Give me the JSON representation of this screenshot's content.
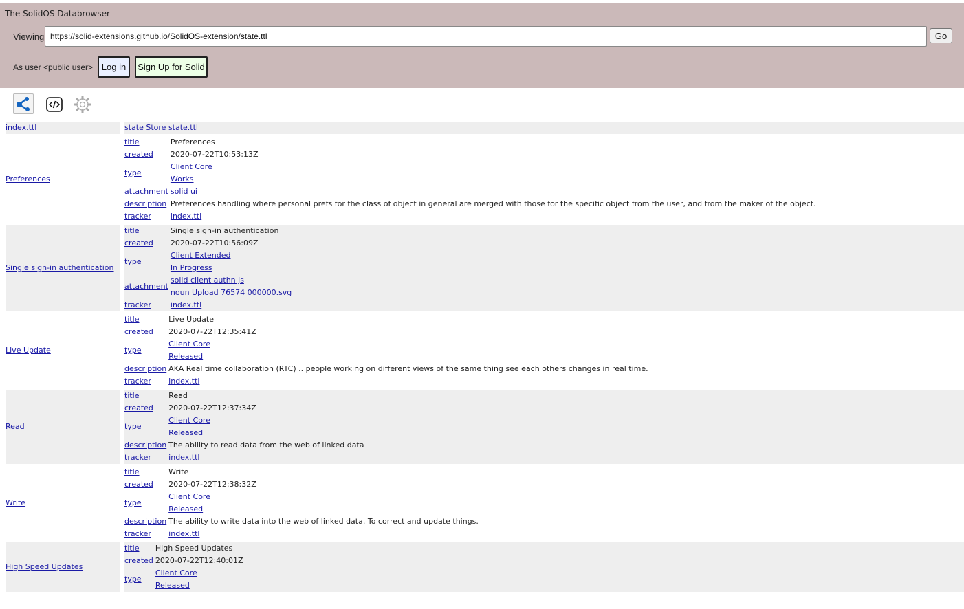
{
  "header": {
    "app_title": "The SolidOS Databrowser",
    "viewing_label": "Viewing",
    "url": "https://solid-extensions.github.io/SolidOS-extension/state.ttl",
    "go_label": "Go",
    "user_label": "As user <public user>",
    "login_label": "Log in",
    "signup_label": "Sign Up for Solid"
  },
  "views": {
    "outline_icon": "outline-view-icon",
    "source_icon": "source-code-icon",
    "settings_icon": "gear-icon"
  },
  "colors": {
    "header_bg": "#cbb9b9",
    "row_alt_bg": "#eeeeee",
    "link": "#1a1aa6",
    "signup_bg": "#ecffe6",
    "login_bg": "#eaf0ff"
  },
  "first_row": {
    "subject": "index.ttl",
    "predicate": "state Store",
    "object": "state.ttl"
  },
  "items": [
    {
      "subject": "Preferences",
      "props": [
        {
          "pred": "title",
          "values": [
            {
              "text": "Preferences",
              "link": false
            }
          ]
        },
        {
          "pred": "created",
          "values": [
            {
              "text": "2020-07-22T10:53:13Z",
              "link": false
            }
          ]
        },
        {
          "pred": "type",
          "values": [
            {
              "text": "Client Core",
              "link": true
            },
            {
              "text": "Works",
              "link": true
            }
          ]
        },
        {
          "pred": "attachment",
          "values": [
            {
              "text": "solid ui",
              "link": true
            }
          ]
        },
        {
          "pred": "description",
          "values": [
            {
              "text": "Preferences handling where personal prefs for the class of object in general are merged with those for the specific object from the user, and from the maker of the object.",
              "link": false
            }
          ]
        },
        {
          "pred": "tracker",
          "values": [
            {
              "text": "index.ttl",
              "link": true
            }
          ]
        }
      ]
    },
    {
      "subject": "Single sign-in authentication",
      "props": [
        {
          "pred": "title",
          "values": [
            {
              "text": "Single sign-in authentication",
              "link": false
            }
          ]
        },
        {
          "pred": "created",
          "values": [
            {
              "text": "2020-07-22T10:56:09Z",
              "link": false
            }
          ]
        },
        {
          "pred": "type",
          "values": [
            {
              "text": "Client Extended",
              "link": true
            },
            {
              "text": "In Progress",
              "link": true
            }
          ]
        },
        {
          "pred": "attachment",
          "values": [
            {
              "text": "solid client authn js",
              "link": true
            },
            {
              "text": "noun Upload 76574 000000.svg",
              "link": true
            }
          ]
        },
        {
          "pred": "tracker",
          "values": [
            {
              "text": "index.ttl",
              "link": true
            }
          ]
        }
      ]
    },
    {
      "subject": "Live Update",
      "props": [
        {
          "pred": "title",
          "values": [
            {
              "text": "Live Update",
              "link": false
            }
          ]
        },
        {
          "pred": "created",
          "values": [
            {
              "text": "2020-07-22T12:35:41Z",
              "link": false
            }
          ]
        },
        {
          "pred": "type",
          "values": [
            {
              "text": "Client Core",
              "link": true
            },
            {
              "text": "Released",
              "link": true
            }
          ]
        },
        {
          "pred": "description",
          "values": [
            {
              "text": "AKA Real time collaboration (RTC) .. people working on different views of the same thing see each others changes in real time.",
              "link": false
            }
          ]
        },
        {
          "pred": "tracker",
          "values": [
            {
              "text": "index.ttl",
              "link": true
            }
          ]
        }
      ]
    },
    {
      "subject": "Read",
      "props": [
        {
          "pred": "title",
          "values": [
            {
              "text": "Read",
              "link": false
            }
          ]
        },
        {
          "pred": "created",
          "values": [
            {
              "text": "2020-07-22T12:37:34Z",
              "link": false
            }
          ]
        },
        {
          "pred": "type",
          "values": [
            {
              "text": "Client Core",
              "link": true
            },
            {
              "text": "Released",
              "link": true
            }
          ]
        },
        {
          "pred": "description",
          "values": [
            {
              "text": "The ability to read data from the web of linked data",
              "link": false
            }
          ]
        },
        {
          "pred": "tracker",
          "values": [
            {
              "text": "index.ttl",
              "link": true
            }
          ]
        }
      ]
    },
    {
      "subject": "Write",
      "props": [
        {
          "pred": "title",
          "values": [
            {
              "text": "Write",
              "link": false
            }
          ]
        },
        {
          "pred": "created",
          "values": [
            {
              "text": "2020-07-22T12:38:32Z",
              "link": false
            }
          ]
        },
        {
          "pred": "type",
          "values": [
            {
              "text": "Client Core",
              "link": true
            },
            {
              "text": "Released",
              "link": true
            }
          ]
        },
        {
          "pred": "description",
          "values": [
            {
              "text": "The ability to write data into the web of linked data. To correct and update things.",
              "link": false
            }
          ]
        },
        {
          "pred": "tracker",
          "values": [
            {
              "text": "index.ttl",
              "link": true
            }
          ]
        }
      ]
    },
    {
      "subject": "High Speed Updates",
      "props": [
        {
          "pred": "title",
          "values": [
            {
              "text": "High Speed Updates",
              "link": false
            }
          ]
        },
        {
          "pred": "created",
          "values": [
            {
              "text": "2020-07-22T12:40:01Z",
              "link": false
            }
          ]
        },
        {
          "pred": "type",
          "values": [
            {
              "text": "Client Core",
              "link": true
            },
            {
              "text": "Released",
              "link": true
            }
          ]
        }
      ]
    }
  ]
}
